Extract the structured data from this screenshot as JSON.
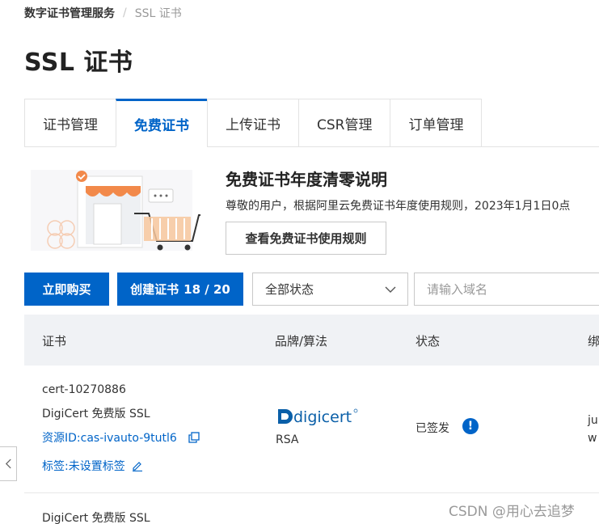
{
  "breadcrumb": {
    "root": "数字证书管理服务",
    "separator": "/",
    "current": "SSL 证书"
  },
  "page_title": "SSL 证书",
  "tabs": [
    {
      "label": "证书管理",
      "active": false
    },
    {
      "label": "免费证书",
      "active": true
    },
    {
      "label": "上传证书",
      "active": false
    },
    {
      "label": "CSR管理",
      "active": false
    },
    {
      "label": "订单管理",
      "active": false
    }
  ],
  "notice": {
    "title": "免费证书年度清零说明",
    "text": "尊敬的用户，根据阿里云免费证书年度使用规则，2023年1月1日0点",
    "button": "查看免费证书使用规则"
  },
  "toolbar": {
    "buy_label": "立即购买",
    "create_label": "创建证书",
    "create_count": "18 / 20",
    "status_select": "全部状态",
    "search_placeholder": "请输入域名"
  },
  "table": {
    "columns": [
      "证书",
      "品牌/算法",
      "状态",
      "绑"
    ],
    "rows": [
      {
        "cert_id": "cert-10270886",
        "cert_name": "DigiCert 免费版 SSL",
        "resource_id": "资源ID:cas-ivauto-9tutl6",
        "tag": "标签:未设置标签",
        "brand_logo": "digicert",
        "algorithm": "RSA",
        "status": "已签发",
        "binding_line1": "ju",
        "binding_line2": "w"
      },
      {
        "cert_name": "DigiCert 免费版 SSL"
      }
    ]
  },
  "watermark": "CSDN @用心去追梦",
  "colors": {
    "primary": "#0064c8",
    "header_bg": "#f0f2f5",
    "border": "#c8c8c8"
  }
}
